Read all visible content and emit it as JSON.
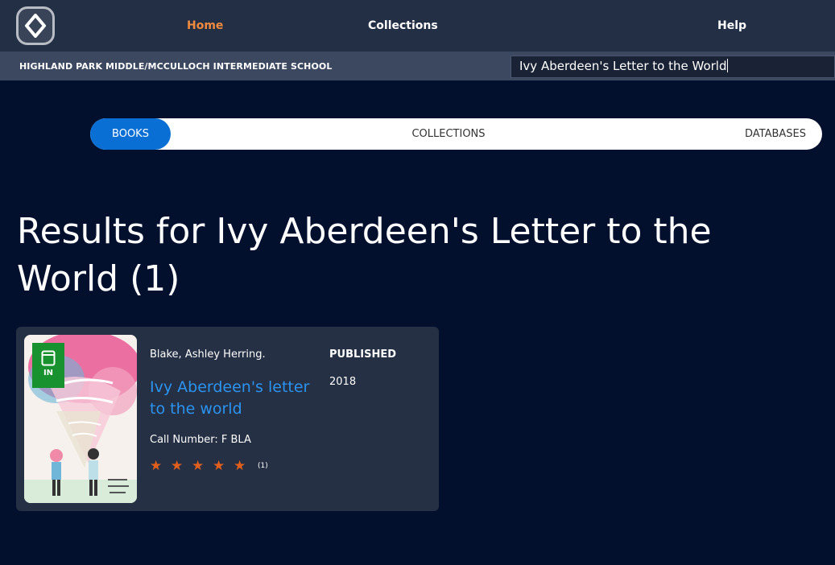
{
  "nav": {
    "logo_icon": "app-logo-icon",
    "home": "Home",
    "collections": "Collections",
    "help": "Help",
    "active_color": "#f08a3e"
  },
  "subbar": {
    "school": "HIGHLAND PARK MIDDLE/MCCULLOCH INTERMEDIATE SCHOOL",
    "search_value": "Ivy Aberdeen's Letter to the World"
  },
  "tabs": {
    "books": "BOOKS",
    "collections": "COLLECTIONS",
    "databases": "DATABASES",
    "active": "BOOKS",
    "active_color": "#0a6fd4"
  },
  "results": {
    "title": "Results for Ivy Aberdeen's Letter to the World (1)"
  },
  "book": {
    "availability": "IN",
    "availability_color": "#18922e",
    "author": "Blake, Ashley Herring.",
    "title": "Ivy Aberdeen's letter to the world",
    "call_number": "Call Number:  F BLA",
    "rating_stars": 5,
    "rating_count": "(1)",
    "published_label": "PUBLISHED",
    "published_year": "2018",
    "title_color": "#2b93f0",
    "star_color": "#e05f1c"
  }
}
